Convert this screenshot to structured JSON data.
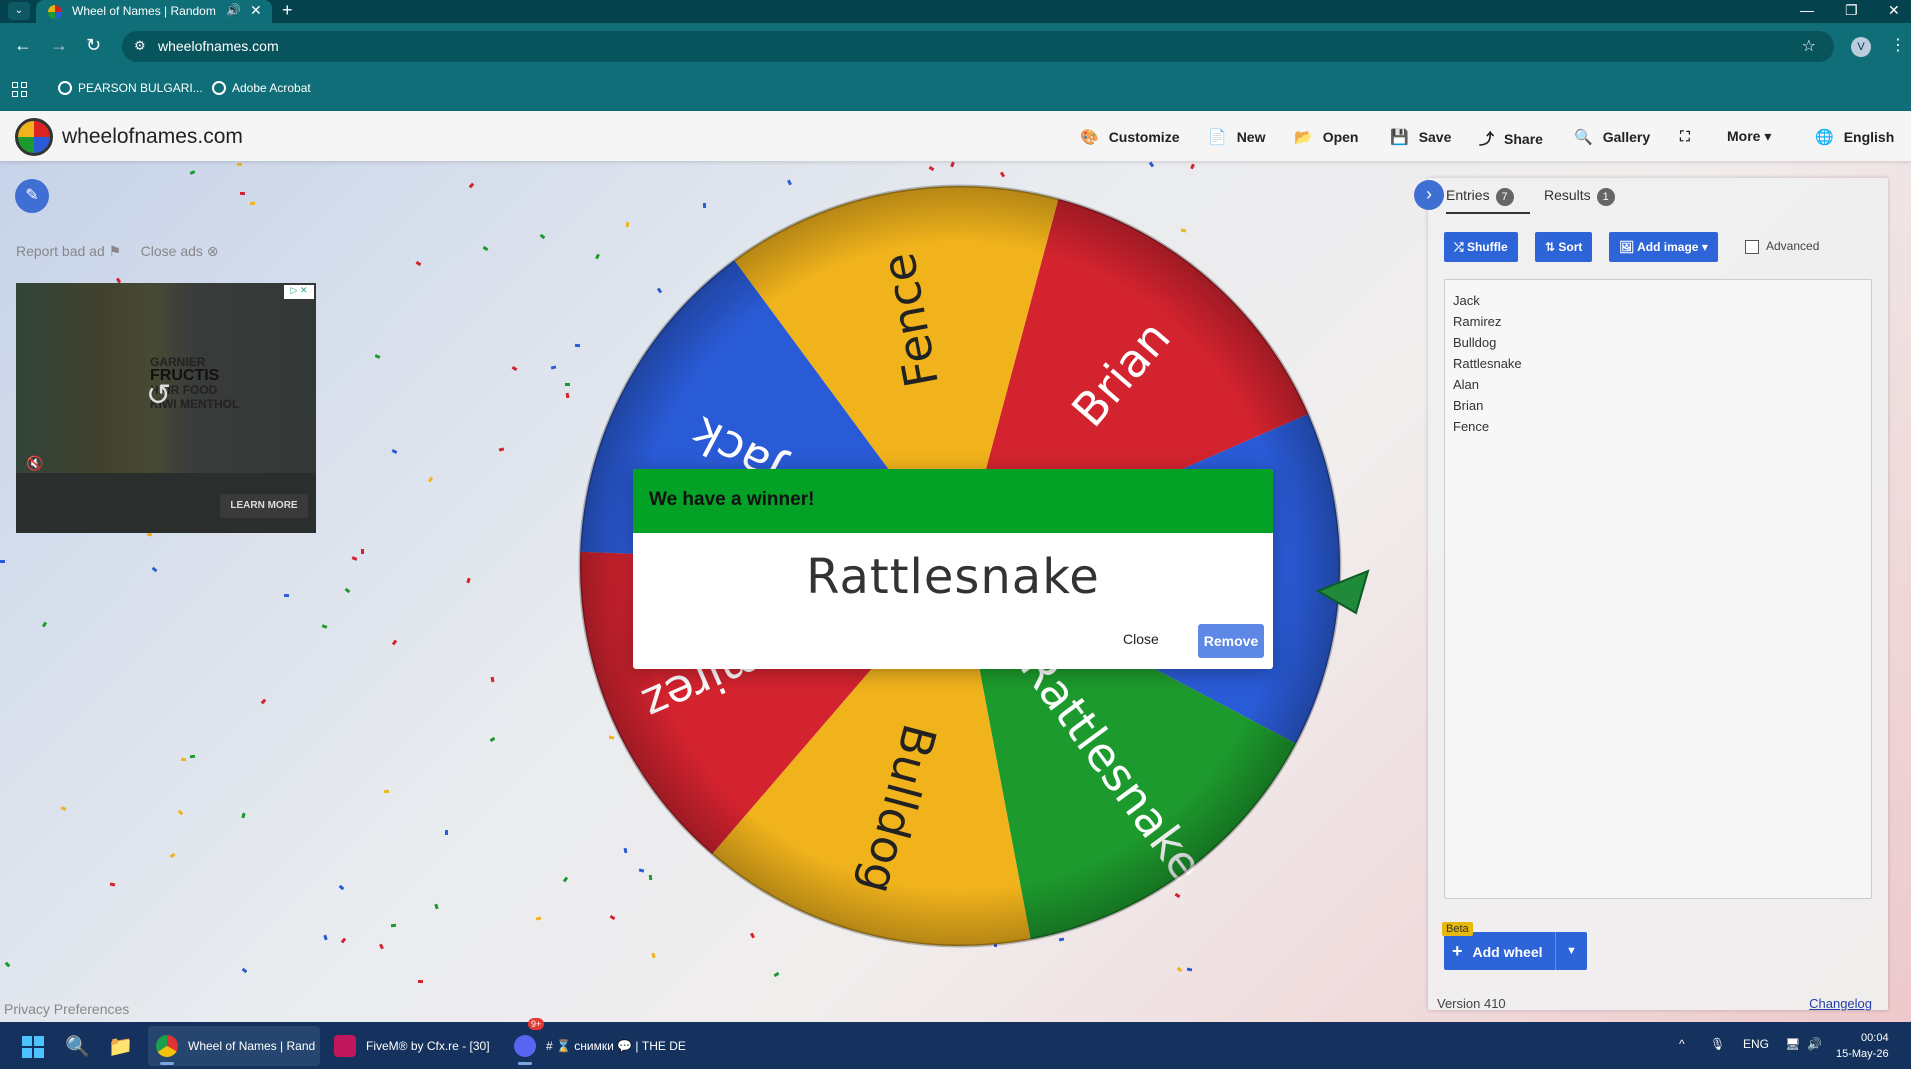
{
  "browser": {
    "tab_title": "Wheel of Names | Random",
    "url": "wheelofnames.com",
    "profile_initial": "V",
    "bookmarks": [
      "PEARSON BULGARI...",
      "Adobe Acrobat"
    ]
  },
  "header": {
    "site_name": "wheelofnames.com",
    "menu": [
      "Customize",
      "New",
      "Open",
      "Save",
      "Share",
      "Gallery",
      "More",
      "English"
    ]
  },
  "ads": {
    "report": "Report bad ad",
    "close": "Close ads",
    "brand_line1": "GARNIER",
    "brand_line2": "FRUCTIS",
    "brand_line3": "HAIR FOOD",
    "brand_line4": "KIWI MENTHOL",
    "learn_more": "LEARN MORE"
  },
  "privacy": "Privacy Preferences",
  "wheel": {
    "segments": [
      {
        "label": "Brian",
        "color": "#d3232f"
      },
      {
        "label": "Alan",
        "color": "#2a5bd7"
      },
      {
        "label": "Rattlesnake",
        "color": "#1d9a2d"
      },
      {
        "label": "Bulldog",
        "color": "#f1b31c"
      },
      {
        "label": "Ramirez",
        "color": "#d3232f"
      },
      {
        "label": "Jack",
        "color": "#2a5bd7"
      },
      {
        "label": "Fence",
        "color": "#f1b31c"
      }
    ]
  },
  "modal": {
    "title": "We have a winner!",
    "winner": "Rattlesnake",
    "close": "Close",
    "remove": "Remove"
  },
  "sidebar": {
    "tab_entries": "Entries",
    "entries_count": "7",
    "tab_results": "Results",
    "results_count": "1",
    "shuffle": "Shuffle",
    "sort": "Sort",
    "add_image": "Add image",
    "advanced": "Advanced",
    "entries": [
      "Jack",
      "Ramirez",
      "Bulldog",
      "Rattlesnake",
      "Alan",
      "Brian",
      "Fence"
    ],
    "beta": "Beta",
    "add_wheel": "Add wheel",
    "version": "Version 410",
    "changelog": "Changelog"
  },
  "taskbar": {
    "apps": [
      "Wheel of Names | Rand",
      "FiveM® by Cfx.re - [30]",
      "# ⌛ снимки 💬 | THE DE"
    ],
    "lang": "ENG",
    "time": "00:04",
    "date": "15-May-26",
    "discord_badge": "9+"
  },
  "colors": {
    "accent": "#2d64d8",
    "winner_header": "#04a127",
    "browser_chrome": "#0f6e77"
  }
}
